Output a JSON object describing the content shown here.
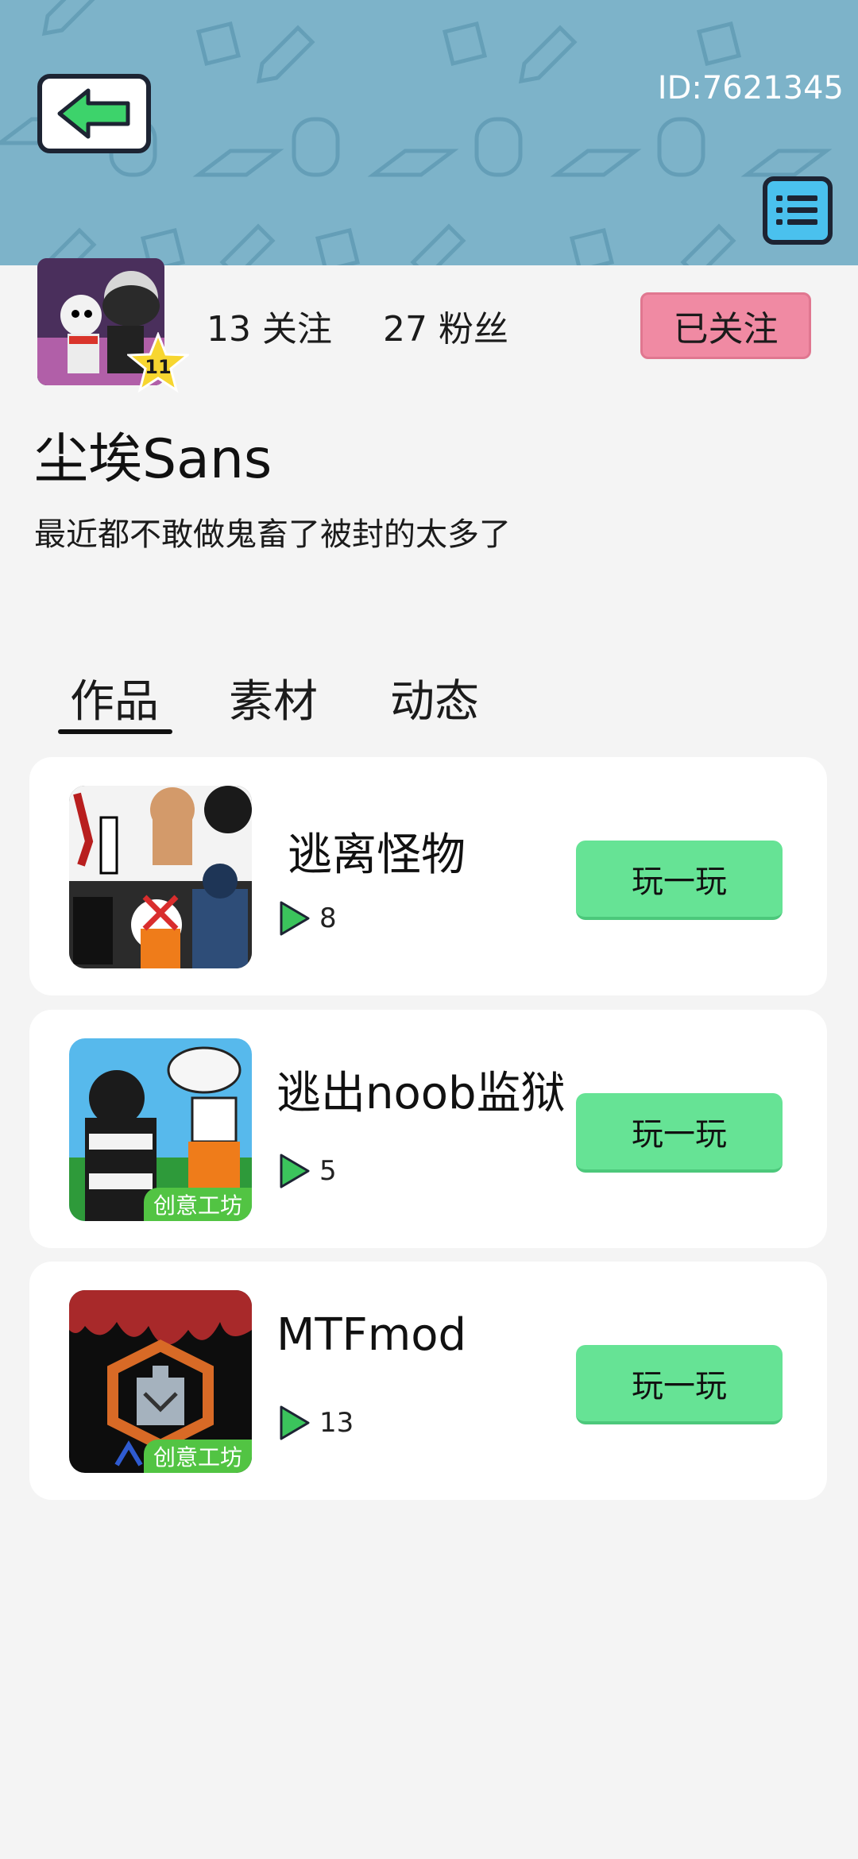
{
  "header": {
    "user_id": "ID:7621345",
    "back_icon": "arrow-left-icon",
    "menu_icon": "list-menu-icon",
    "banner_color": "#7db3c9"
  },
  "profile": {
    "following": "13 关注",
    "fans": "27 粉丝",
    "follow_button": "已关注",
    "level": "11",
    "username": "尘埃Sans",
    "bio": "最近都不敢做鬼畜了被封的太多了"
  },
  "tabs": [
    {
      "label": "作品",
      "active": true
    },
    {
      "label": "素材",
      "active": false
    },
    {
      "label": "动态",
      "active": false
    }
  ],
  "works": [
    {
      "title": "逃离怪物",
      "plays": "8",
      "button": "玩一玩",
      "badge": ""
    },
    {
      "title": "逃出noob监狱",
      "plays": "5",
      "button": "玩一玩",
      "badge": "创意工坊"
    },
    {
      "title": "MTFmod",
      "plays": "13",
      "button": "玩一玩",
      "badge": "创意工坊"
    }
  ],
  "colors": {
    "accent_green": "#66e395",
    "follow_pink": "#f08aa3",
    "badge_green": "#52c443"
  }
}
